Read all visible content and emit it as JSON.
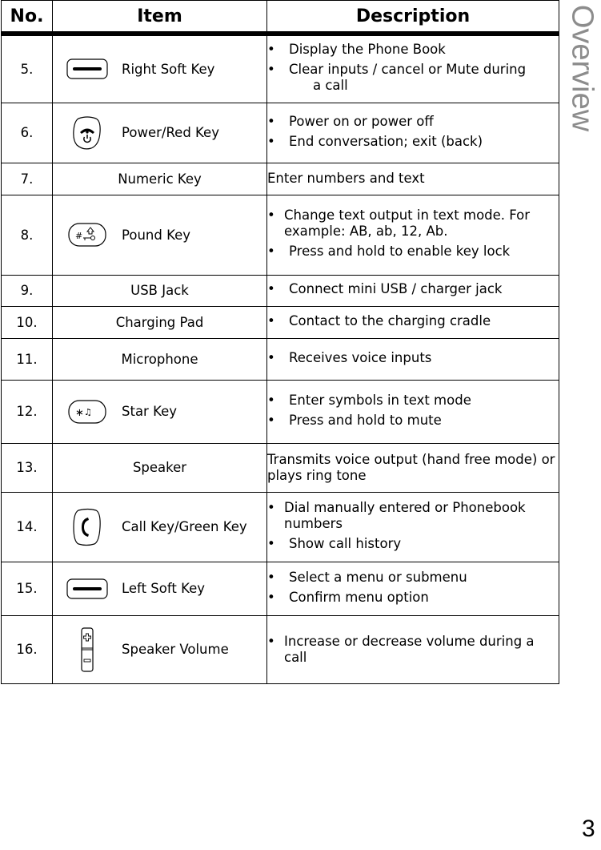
{
  "side_tab": "Overview",
  "page_number": "3",
  "table": {
    "headers": {
      "no": "No.",
      "item": "Item",
      "description": "Description"
    },
    "rows": [
      {
        "no": "5.",
        "item": "Right Soft Key",
        "icon": "soft-key-icon",
        "description": [
          "Display the Phone Book",
          "Clear inputs / cancel or Mute during",
          "a call"
        ]
      },
      {
        "no": "6.",
        "item": "Power/Red Key",
        "icon": "power-end-key-icon",
        "description": [
          "Power on or power off",
          "End conversation; exit (back)"
        ]
      },
      {
        "no": "7.",
        "item": "Numeric Key",
        "icon": null,
        "description_plain": "Enter numbers and text"
      },
      {
        "no": "8.",
        "item": "Pound Key",
        "icon": "pound-key-icon",
        "description": [
          "Change text output in text mode. For example: AB, ab, 12, Ab.",
          "Press and hold to enable key lock"
        ]
      },
      {
        "no": "9.",
        "item": "USB Jack",
        "icon": null,
        "description": [
          "Connect mini USB / charger jack"
        ]
      },
      {
        "no": "10.",
        "item": "Charging Pad",
        "icon": null,
        "description": [
          "Contact to the charging cradle"
        ]
      },
      {
        "no": "11.",
        "item": "Microphone",
        "icon": null,
        "description": [
          "Receives voice inputs"
        ]
      },
      {
        "no": "12.",
        "item": "Star Key",
        "icon": "star-key-icon",
        "description": [
          "Enter symbols in text mode",
          "Press and hold to mute"
        ]
      },
      {
        "no": "13.",
        "item": "Speaker",
        "icon": null,
        "description_plain": "Transmits voice output (hand free mode) or plays ring tone"
      },
      {
        "no": "14.",
        "item": "Call Key/Green Key",
        "icon": "call-key-icon",
        "description": [
          "Dial manually entered or Phonebook numbers",
          "Show call history"
        ]
      },
      {
        "no": "15.",
        "item": "Left Soft Key",
        "icon": "soft-key-icon",
        "description": [
          "Select a menu or submenu",
          "Confirm menu option"
        ]
      },
      {
        "no": "16.",
        "item": "Speaker Volume",
        "icon": "volume-key-icon",
        "description": [
          "Increase or decrease volume during a call"
        ]
      }
    ]
  }
}
